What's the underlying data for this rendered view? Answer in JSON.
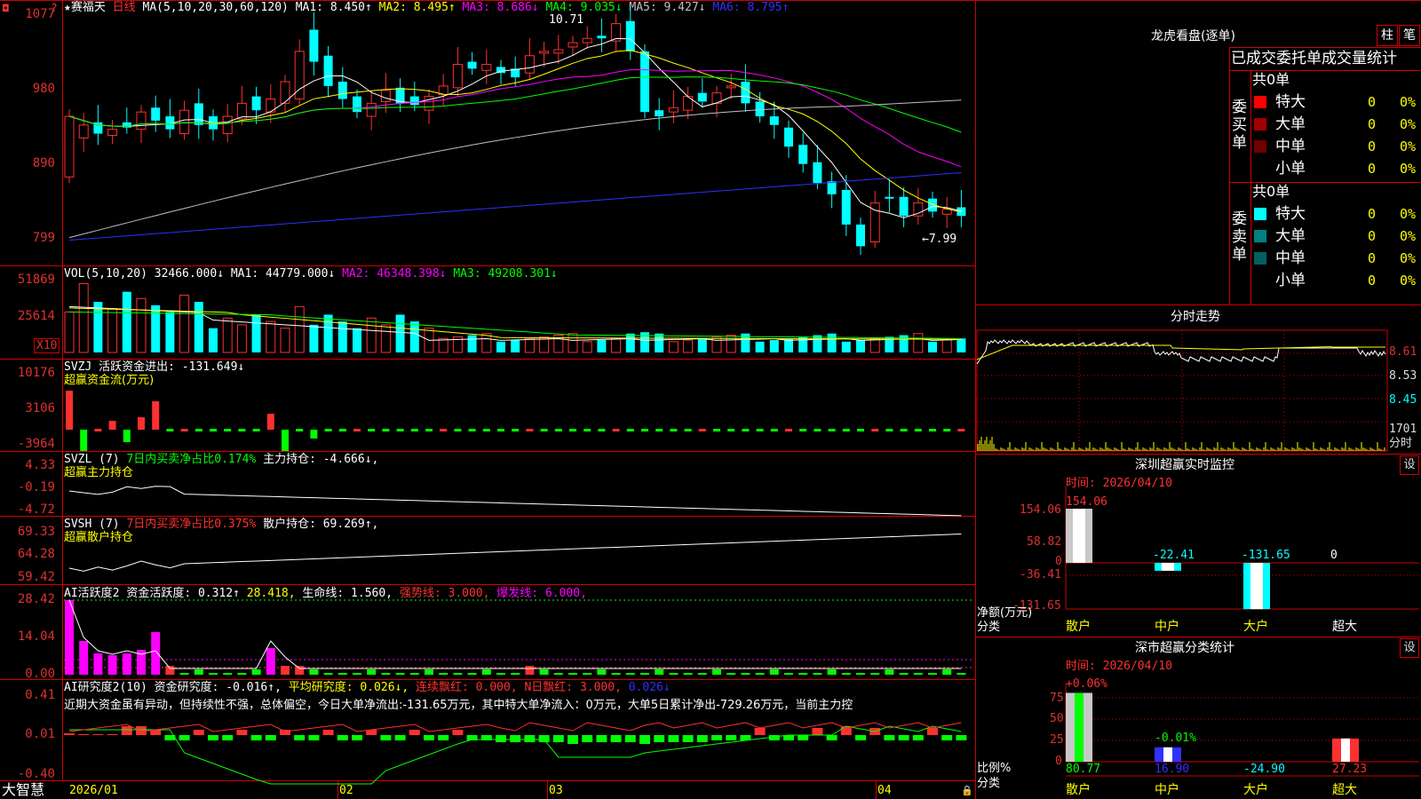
{
  "header": {
    "stock": "★赛福天",
    "period": "日线",
    "ma_label": "MA(5,10,20,30,60,120)",
    "ma": [
      {
        "name": "MA1:",
        "value": "8.450",
        "arrow": "↑",
        "color": "#ffffff"
      },
      {
        "name": "MA2:",
        "value": "8.495",
        "arrow": "↑",
        "color": "#ffff00"
      },
      {
        "name": "MA3:",
        "value": "8.686",
        "arrow": "↓",
        "color": "#ff00ff"
      },
      {
        "name": "MA4:",
        "value": "9.035",
        "arrow": "↓",
        "color": "#00ff00"
      },
      {
        "name": "MA5:",
        "value": "9.427",
        "arrow": "↓",
        "color": "#c0c0c0"
      },
      {
        "name": "MA6:",
        "value": "8.795",
        "arrow": "↑",
        "color": "#3030ff"
      }
    ],
    "high_label": "10.71",
    "low_label": "←7.99"
  },
  "axes": {
    "price": [
      "1077",
      "980",
      "890",
      "799"
    ],
    "vol": [
      "51869",
      "25614"
    ],
    "vol_unit": "X10",
    "svzj": [
      "10176",
      "3106",
      "-3964"
    ],
    "svzl": [
      "4.33",
      "-0.19",
      "-4.72"
    ],
    "svsh": [
      "69.33",
      "64.28",
      "59.42"
    ],
    "ai1": [
      "28.42",
      "14.04",
      "0.00"
    ],
    "ai2": [
      "0.41",
      "0.01",
      "-0.40"
    ]
  },
  "panels": {
    "vol": {
      "label": "VOL(5,10,20)",
      "value": "32466.000↓",
      "ma1": "MA1: 44779.000↓",
      "ma2": "MA2: 46348.398↓",
      "ma3": "MA3: 49208.301↓"
    },
    "svzj": {
      "label": "SVZJ",
      "desc": "活跃资金进出: -131.649↓",
      "sub": "超赢资金流(万元)"
    },
    "svzl": {
      "label": "SVZL (7)",
      "desc": "7日内买卖净占比0.174%",
      "value": "主力持仓: -4.666↓,",
      "sub": "超赢主力持仓"
    },
    "svsh": {
      "label": "SVSH (7)",
      "desc": "7日内买卖净占比0.375%",
      "value": "散户持仓: 69.269↑,",
      "sub": "超赢散户持仓"
    },
    "ai1": {
      "label": "AI活跃度2",
      "v1": "资金活跃度: 0.312↑",
      "v2": "28.418,",
      "v3": "生命线: 1.560,",
      "v4": "强势线: 3.000,",
      "v5": "爆发线: 6.000,"
    },
    "ai2": {
      "label": "AI研究度2(10)",
      "v1": "资金研究度: -0.016↑,",
      "v2": "平均研究度: 0.026↓,",
      "v3": "连续飘红: 0.000,",
      "v4": "N日飘红: 3.000,",
      "v5": "0.026↓",
      "comment": "近期大资金虽有异动，但持续性不强，总体偏空，今日大单净流出:-131.65万元，其中特大单净流入：0万元，大单5日累计净出-729.26万元，当前主力控"
    }
  },
  "bottom_bar": {
    "brand": "大智慧",
    "dates": [
      "2026/01",
      "02",
      "03",
      "04"
    ]
  },
  "longhu": {
    "title": "龙虎看盘(逐单)",
    "btn_bar": "柱",
    "btn_count": "笔",
    "tabs": "已成交委托单成交量统计",
    "buy": {
      "side": "委买单",
      "total": "共0单",
      "rows": [
        {
          "name": "特大",
          "count": "0",
          "pct": "0%",
          "color": "#ff0000"
        },
        {
          "name": "大单",
          "count": "0",
          "pct": "0%",
          "color": "#a00000"
        },
        {
          "name": "中单",
          "count": "0",
          "pct": "0%",
          "color": "#700000"
        },
        {
          "name": "小单",
          "count": "0",
          "pct": "0%",
          "color": ""
        }
      ]
    },
    "sell": {
      "side": "委卖单",
      "total": "共0单",
      "rows": [
        {
          "name": "特大",
          "count": "0",
          "pct": "0%",
          "color": "#00ffff"
        },
        {
          "name": "大单",
          "count": "0",
          "pct": "0%",
          "color": "#008080"
        },
        {
          "name": "中单",
          "count": "0",
          "pct": "0%",
          "color": "#006060"
        },
        {
          "name": "小单",
          "count": "0",
          "pct": "0%",
          "color": ""
        }
      ]
    }
  },
  "intraday": {
    "title": "分时走势",
    "y": [
      "8.61",
      "8.53",
      "8.45"
    ],
    "vol": "1701",
    "vol_unit": "分时"
  },
  "monitor": {
    "title": "深圳超赢实时监控",
    "gear": "设",
    "time": "时间: 2026/04/10",
    "y": [
      "154.06",
      "58.82",
      "0",
      "-36.41",
      "-131.65"
    ],
    "ylabel": "净额(万元)",
    "xlabel": "分类",
    "cats": [
      "散户",
      "中户",
      "大户",
      "超大"
    ],
    "values": [
      154.06,
      -22.41,
      -131.65,
      0
    ],
    "value_labels": [
      "154.06",
      "-22.41",
      "-131.65",
      "0"
    ]
  },
  "classify": {
    "title": "深市超赢分类统计",
    "gear": "设",
    "time": "时间: 2026/04/10",
    "y": [
      "75",
      "50",
      "25",
      "0"
    ],
    "ylabel": "比例%",
    "xlabel": "分类",
    "cats": [
      "散户",
      "中户",
      "大户",
      "超大"
    ],
    "pct_labels": [
      "+0.06%",
      "-0.01%"
    ],
    "values": [
      "80.77",
      "16.90",
      "-24.90",
      "27.23"
    ]
  },
  "colors": {
    "up": "#ff3030",
    "down": "#00ffff",
    "frame": "#d00000",
    "green": "#00ff00",
    "yellow": "#ffff00",
    "magenta": "#ff00ff"
  }
}
